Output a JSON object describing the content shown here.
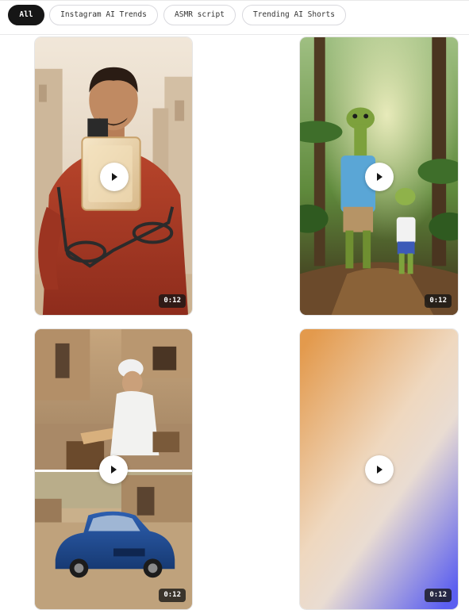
{
  "filters": [
    {
      "label": "All",
      "active": true
    },
    {
      "label": "Instagram AI Trends",
      "active": false
    },
    {
      "label": "ASMR script",
      "active": false
    },
    {
      "label": "Trending AI Shorts",
      "active": false
    }
  ],
  "videos": [
    {
      "name": "perfume-bottle-video",
      "duration": "0:12"
    },
    {
      "name": "snake-jungle-video",
      "duration": "0:12"
    },
    {
      "name": "woodcarver-car-video",
      "duration": "0:12"
    },
    {
      "name": "gradient-placeholder-video",
      "duration": "0:12"
    }
  ],
  "colors": {
    "active_chip_bg": "#161616",
    "gradient_top": "#e39a4d",
    "gradient_bottom": "#5b5ff0"
  }
}
